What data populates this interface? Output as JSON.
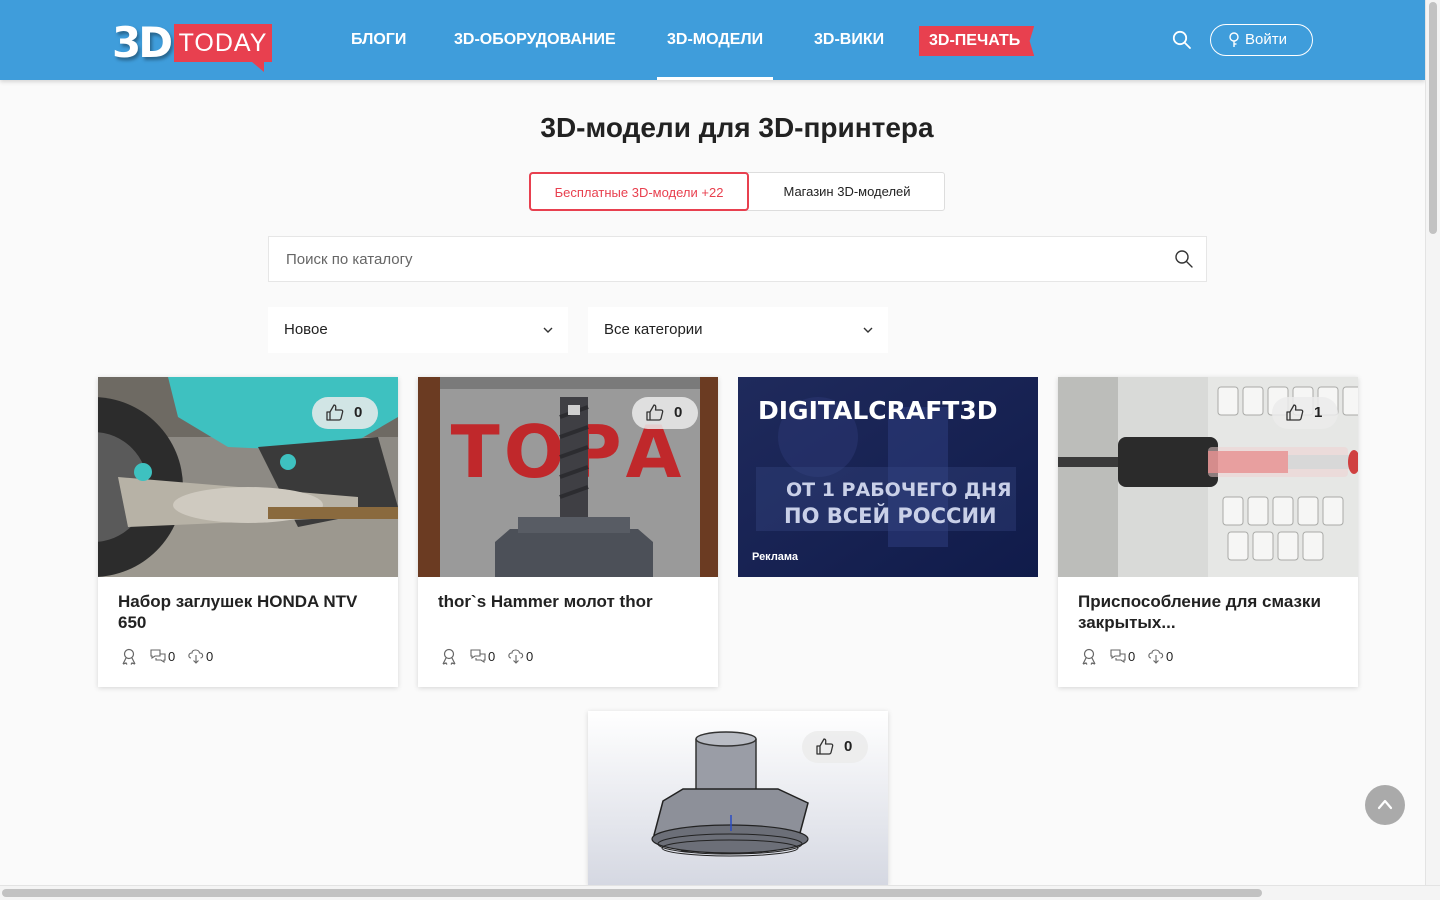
{
  "header": {
    "logo_3d": "3D",
    "logo_today": "TODAY",
    "nav": [
      {
        "label": "БЛОГИ"
      },
      {
        "label": "3D-ОБОРУДОВАНИЕ"
      },
      {
        "label": "3D-МОДЕЛИ"
      },
      {
        "label": "3D-ВИКИ"
      }
    ],
    "nav_print": "3D-ПЕЧАТЬ",
    "login_label": "Войти"
  },
  "page": {
    "title": "3D-модели для 3D-принтера",
    "tabs": [
      {
        "label": "Бесплатные 3D-модели +22",
        "active": true
      },
      {
        "label": "Магазин 3D-моделей",
        "active": false
      }
    ],
    "search_placeholder": "Поиск по каталогу",
    "sort_value": "Новое",
    "category_value": "Все категории"
  },
  "cards": [
    {
      "title": "Набор заглушек HONDA NTV 650",
      "likes": "0",
      "comments": "0",
      "downloads": "0"
    },
    {
      "title": "thor`s Hammer молот thor",
      "likes": "0",
      "comments": "0",
      "downloads": "0"
    },
    {
      "ad_title": "DIGITALCRAFT3D",
      "ad_line1": "ОТ 1 РАБОЧЕГО ДНЯ",
      "ad_line2": "ПО ВСЕЙ РОССИИ",
      "ad_label": "Реклама"
    },
    {
      "title": "Приспособление для смазки закрытых...",
      "likes": "1",
      "comments": "0",
      "downloads": "0"
    },
    {
      "likes": "0"
    }
  ],
  "colors": {
    "header_bg": "#3f9ddb",
    "accent_red": "#e8404f",
    "page_bg": "#fafafa"
  }
}
